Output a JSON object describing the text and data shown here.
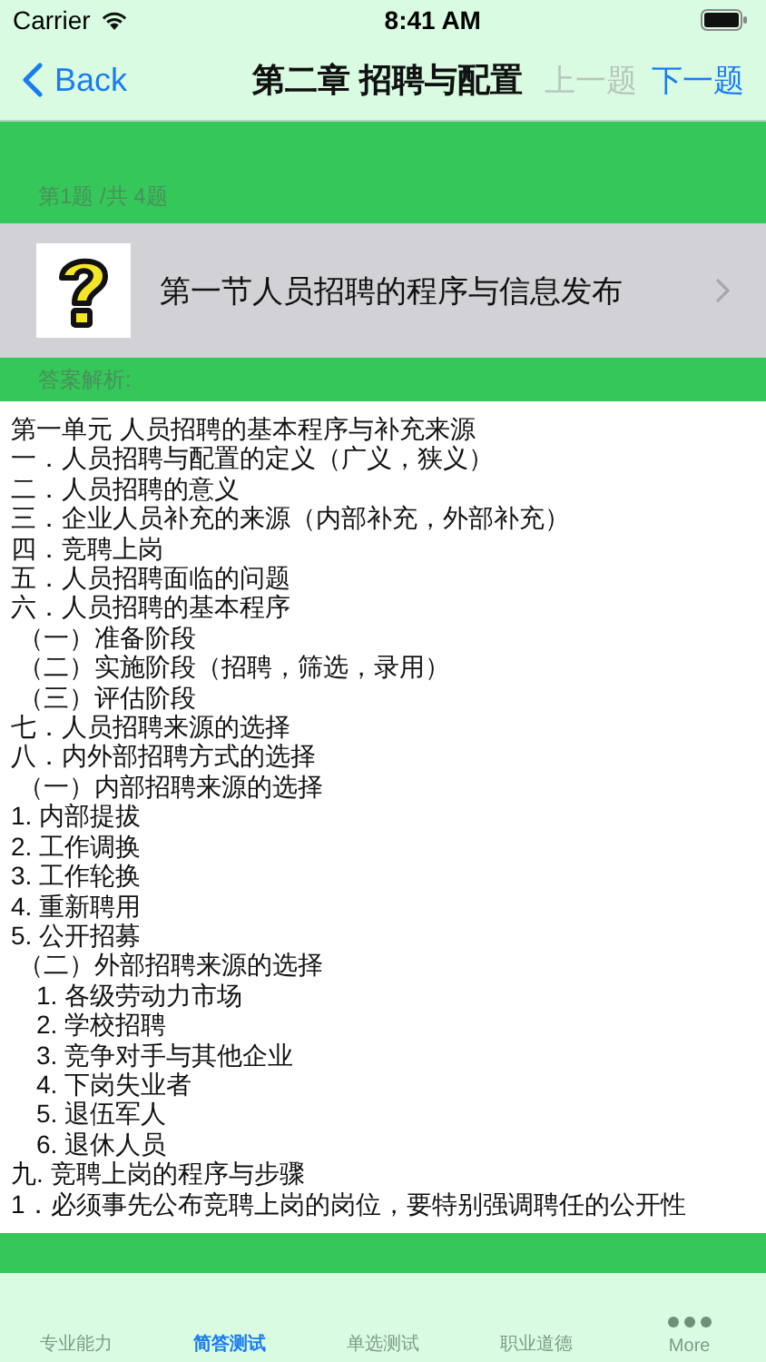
{
  "status_bar": {
    "carrier": "Carrier",
    "time": "8:41 AM"
  },
  "nav": {
    "back": "Back",
    "title": "第二章 招聘与配置",
    "prev": {
      "label": "上一题",
      "disabled": true
    },
    "next": {
      "label": "下一题",
      "disabled": false
    }
  },
  "counter": "第1题 /共 4题",
  "question": {
    "title": "第一节人员招聘的程序与信息发布"
  },
  "answer_label": "答案解析:",
  "answer_lines": [
    {
      "kind": "line",
      "text": "第一单元 人员招聘的基本程序与补充来源"
    },
    {
      "kind": "line",
      "text": "一．人员招聘与配置的定义（广义，狭义）"
    },
    {
      "kind": "line",
      "text": "二．人员招聘的意义"
    },
    {
      "kind": "line",
      "text": "三．企业人员补充的来源（内部补充，外部补充）"
    },
    {
      "kind": "line",
      "text": "四．竞聘上岗"
    },
    {
      "kind": "line",
      "text": "五．人员招聘面临的问题"
    },
    {
      "kind": "line",
      "text": "六．人员招聘的基本程序"
    },
    {
      "kind": "sub",
      "text": "（一）准备阶段"
    },
    {
      "kind": "sub",
      "text": "（二）实施阶段（招聘，筛选，录用）"
    },
    {
      "kind": "sub",
      "text": "（三）评估阶段"
    },
    {
      "kind": "line",
      "text": "七．人员招聘来源的选择"
    },
    {
      "kind": "line",
      "text": "八．内外部招聘方式的选择"
    },
    {
      "kind": "sub",
      "text": "（一）内部招聘来源的选择"
    },
    {
      "kind": "line",
      "text": "1. 内部提拔"
    },
    {
      "kind": "line",
      "text": "2. 工作调换"
    },
    {
      "kind": "line",
      "text": "3. 工作轮换"
    },
    {
      "kind": "line",
      "text": "4. 重新聘用"
    },
    {
      "kind": "line",
      "text": "5. 公开招募"
    },
    {
      "kind": "sub",
      "text": "（二）外部招聘来源的选择"
    },
    {
      "kind": "item",
      "text": "1. 各级劳动力市场"
    },
    {
      "kind": "item",
      "text": "2. 学校招聘"
    },
    {
      "kind": "item",
      "text": "3. 竞争对手与其他企业"
    },
    {
      "kind": "item",
      "text": "4. 下岗失业者"
    },
    {
      "kind": "item",
      "text": "5. 退伍军人"
    },
    {
      "kind": "item",
      "text": "6. 退休人员"
    },
    {
      "kind": "line",
      "text": "九. 竞聘上岗的程序与步骤"
    },
    {
      "kind": "line",
      "text": "1．必须事先公布竞聘上岗的岗位，要特别强调聘任的公开性"
    }
  ],
  "tabs": [
    {
      "label": "专业能力",
      "selected": false
    },
    {
      "label": "简答测试",
      "selected": true
    },
    {
      "label": "单选测试",
      "selected": false
    },
    {
      "label": "职业道德",
      "selected": false
    },
    {
      "label": "More",
      "selected": false,
      "kind": "more"
    }
  ]
}
